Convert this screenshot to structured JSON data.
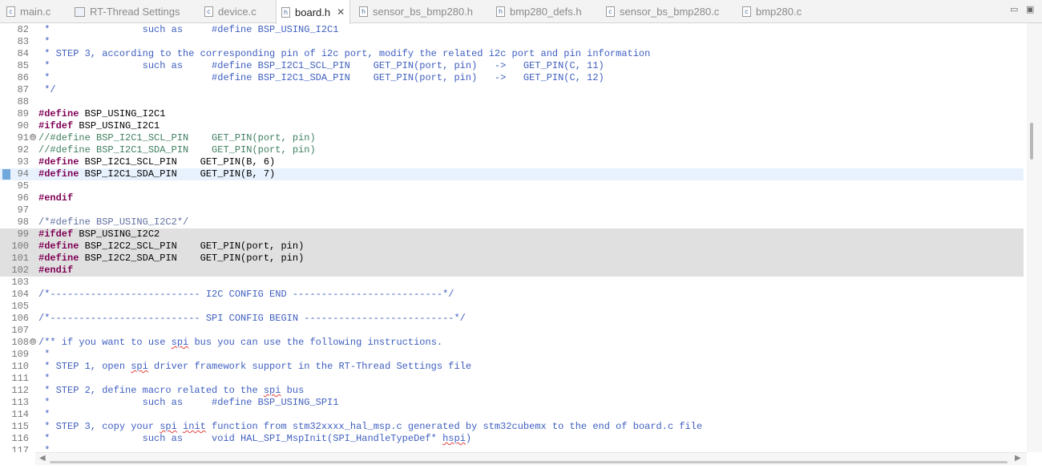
{
  "tabs": [
    {
      "label": "main.c",
      "icon": "c-file-icon",
      "active": false
    },
    {
      "label": "RT-Thread Settings",
      "icon": "settings-icon",
      "active": false
    },
    {
      "label": "device.c",
      "icon": "c-file-icon",
      "active": false
    },
    {
      "label": "board.h",
      "icon": "h-file-icon",
      "active": true,
      "close": "✕"
    },
    {
      "label": "sensor_bs_bmp280.h",
      "icon": "h-file-icon",
      "active": false
    },
    {
      "label": "bmp280_defs.h",
      "icon": "h-file-icon",
      "active": false
    },
    {
      "label": "sensor_bs_bmp280.c",
      "icon": "c-file-icon",
      "active": false
    },
    {
      "label": "bmp280.c",
      "icon": "c-file-icon",
      "active": false
    }
  ],
  "window_controls": {
    "minimize": "▭",
    "maximize": "▣"
  },
  "colors": {
    "keyword": "#7f0055",
    "comment": "#3f5fbf",
    "line_comment": "#3f7f5f",
    "current_line": "#e8f2fe",
    "inactive_block": "#e0e0e0",
    "marker": "#5b9bd5"
  },
  "lines": [
    {
      "n": "82",
      "tokens": [
        {
          "t": "cm",
          "v": " *                such as     #define BSP_USING_I2C1"
        }
      ]
    },
    {
      "n": "83",
      "tokens": [
        {
          "t": "cm",
          "v": " *"
        }
      ]
    },
    {
      "n": "84",
      "tokens": [
        {
          "t": "cm",
          "v": " * STEP 3, according to the corresponding pin of i2c port, modify the related i2c port and pin information"
        }
      ]
    },
    {
      "n": "85",
      "tokens": [
        {
          "t": "cm",
          "v": " *                such as     #define BSP_I2C1_SCL_PIN    GET_PIN(port, pin)   ->   GET_PIN(C, 11)"
        }
      ]
    },
    {
      "n": "86",
      "tokens": [
        {
          "t": "cm",
          "v": " *                            #define BSP_I2C1_SDA_PIN    GET_PIN(port, pin)   ->   GET_PIN(C, 12)"
        }
      ]
    },
    {
      "n": "87",
      "tokens": [
        {
          "t": "cm",
          "v": " */"
        }
      ]
    },
    {
      "n": "88",
      "tokens": []
    },
    {
      "n": "89",
      "tokens": [
        {
          "t": "kw",
          "v": "#define"
        },
        {
          "t": "pl",
          "v": " BSP_USING_I2C1"
        }
      ]
    },
    {
      "n": "90",
      "tokens": [
        {
          "t": "kw",
          "v": "#ifdef"
        },
        {
          "t": "pl",
          "v": " BSP_USING_I2C1"
        }
      ]
    },
    {
      "n": "91",
      "fold": "⊖",
      "tokens": [
        {
          "t": "lc",
          "v": "//#define BSP_I2C1_SCL_PIN    GET_PIN(port, pin)"
        }
      ]
    },
    {
      "n": "92",
      "tokens": [
        {
          "t": "lc",
          "v": "//#define BSP_I2C1_SDA_PIN    GET_PIN(port, pin)"
        }
      ]
    },
    {
      "n": "93",
      "tokens": [
        {
          "t": "kw",
          "v": "#define"
        },
        {
          "t": "pl",
          "v": " BSP_I2C1_SCL_PIN    GET_PIN(B, 6)"
        }
      ]
    },
    {
      "n": "94",
      "current": true,
      "marker": true,
      "tokens": [
        {
          "t": "kw",
          "v": "#define"
        },
        {
          "t": "pl",
          "v": " BSP_I2C1_SDA_PIN    GET_PIN(B, 7)"
        }
      ]
    },
    {
      "n": "95",
      "tokens": []
    },
    {
      "n": "96",
      "tokens": [
        {
          "t": "kw",
          "v": "#endif"
        }
      ]
    },
    {
      "n": "97",
      "tokens": []
    },
    {
      "n": "98",
      "tokens": [
        {
          "t": "mc",
          "v": "/*#define BSP_USING_I2C2*/"
        }
      ]
    },
    {
      "n": "99",
      "inactive": true,
      "tokens": [
        {
          "t": "kw",
          "v": "#ifdef"
        },
        {
          "t": "pl",
          "v": " BSP_USING_I2C2"
        }
      ]
    },
    {
      "n": "100",
      "inactive": true,
      "tokens": [
        {
          "t": "kw",
          "v": "#define"
        },
        {
          "t": "pl",
          "v": " BSP_I2C2_SCL_PIN    GET_PIN(port, pin)"
        }
      ]
    },
    {
      "n": "101",
      "inactive": true,
      "tokens": [
        {
          "t": "kw",
          "v": "#define"
        },
        {
          "t": "pl",
          "v": " BSP_I2C2_SDA_PIN    GET_PIN(port, pin)"
        }
      ]
    },
    {
      "n": "102",
      "inactive": true,
      "tokens": [
        {
          "t": "kw",
          "v": "#endif"
        }
      ]
    },
    {
      "n": "103",
      "tokens": []
    },
    {
      "n": "104",
      "tokens": [
        {
          "t": "cm",
          "v": "/*-------------------------- I2C CONFIG END --------------------------*/"
        }
      ]
    },
    {
      "n": "105",
      "tokens": []
    },
    {
      "n": "106",
      "tokens": [
        {
          "t": "cm",
          "v": "/*-------------------------- SPI CONFIG BEGIN --------------------------*/"
        }
      ]
    },
    {
      "n": "107",
      "tokens": []
    },
    {
      "n": "108",
      "fold": "⊖",
      "tokens": [
        {
          "t": "cm",
          "v": "/** if you want to use "
        },
        {
          "t": "cm",
          "sq": true,
          "v": "spi"
        },
        {
          "t": "cm",
          "v": " bus you can use the following instructions."
        }
      ]
    },
    {
      "n": "109",
      "tokens": [
        {
          "t": "cm",
          "v": " *"
        }
      ]
    },
    {
      "n": "110",
      "tokens": [
        {
          "t": "cm",
          "v": " * STEP 1, open "
        },
        {
          "t": "cm",
          "sq": true,
          "v": "spi"
        },
        {
          "t": "cm",
          "v": " driver framework support in the RT-Thread Settings file"
        }
      ]
    },
    {
      "n": "111",
      "tokens": [
        {
          "t": "cm",
          "v": " *"
        }
      ]
    },
    {
      "n": "112",
      "tokens": [
        {
          "t": "cm",
          "v": " * STEP 2, define macro related to the "
        },
        {
          "t": "cm",
          "sq": true,
          "v": "spi"
        },
        {
          "t": "cm",
          "v": " bus"
        }
      ]
    },
    {
      "n": "113",
      "tokens": [
        {
          "t": "cm",
          "v": " *                such as     #define BSP_USING_SPI1"
        }
      ]
    },
    {
      "n": "114",
      "tokens": [
        {
          "t": "cm",
          "v": " *"
        }
      ]
    },
    {
      "n": "115",
      "tokens": [
        {
          "t": "cm",
          "v": " * STEP 3, copy your "
        },
        {
          "t": "cm",
          "sq": true,
          "v": "spi"
        },
        {
          "t": "cm",
          "v": " "
        },
        {
          "t": "cm",
          "sq": true,
          "v": "init"
        },
        {
          "t": "cm",
          "v": " function from stm32xxxx_hal_msp.c generated by stm32cubemx to the end of board.c file"
        }
      ]
    },
    {
      "n": "116",
      "tokens": [
        {
          "t": "cm",
          "v": " *                such as     void HAL_SPI_MspInit(SPI_HandleTypeDef* "
        },
        {
          "t": "cm",
          "sq": true,
          "v": "hspi"
        },
        {
          "t": "cm",
          "v": ")"
        }
      ]
    },
    {
      "n": "117",
      "tokens": [
        {
          "t": "cm",
          "v": " *"
        }
      ]
    }
  ],
  "hscroll": {
    "left": "◀",
    "right": "▶"
  }
}
